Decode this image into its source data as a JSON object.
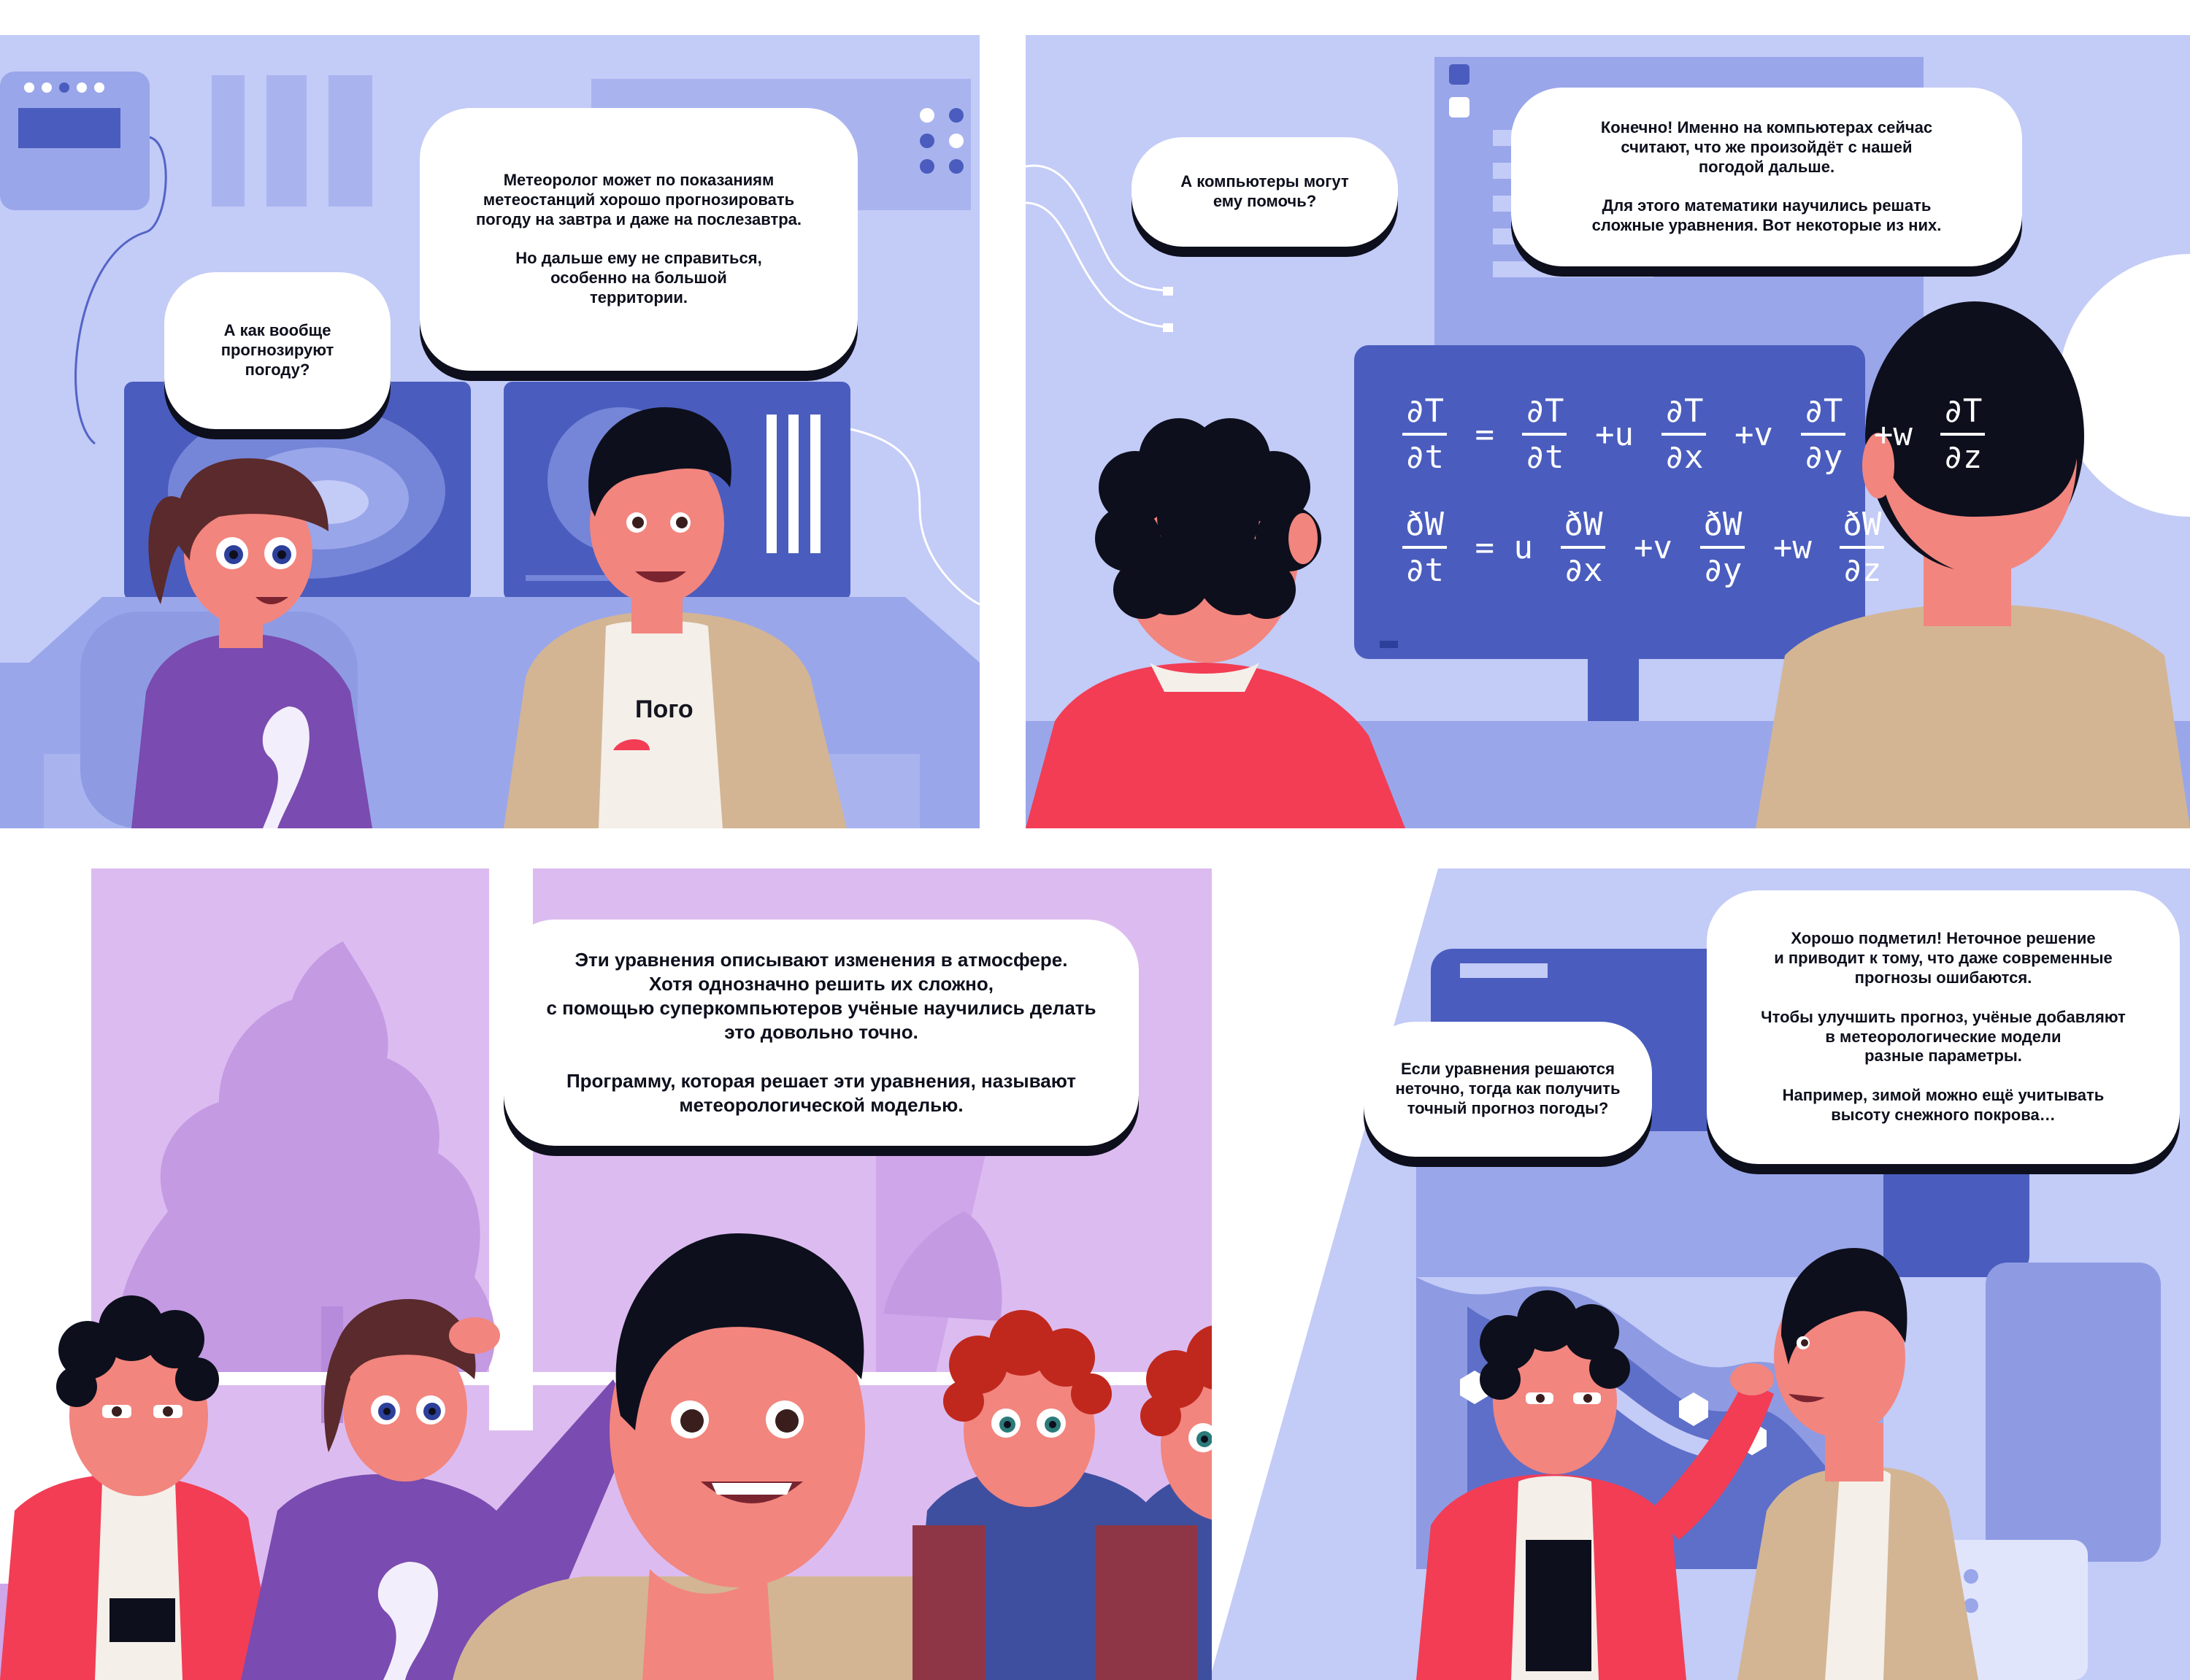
{
  "colors": {
    "panel_bg": "#c3cbf7",
    "screen_dark": "#4a5dbe",
    "screen_light": "#9aa6ea",
    "purple_bg": "#dcbcf0",
    "hoodie": "#7a4bb0",
    "jacket_red": "#f23d55",
    "beige": "#d3b594",
    "skin": "#f2857e",
    "hair": "#0d0f1c"
  },
  "panels": {
    "p1": {
      "girl_bubble": "А как вообще\nпрогнозируют\nпогоду?",
      "man_bubble": "Метеоролог может по показаниям\nметеостанций хорошо прогнозировать\nпогоду на завтра и даже на послезавтра.\n\nНо дальше ему не справиться,\nособенно на большой\nтерритории.",
      "shirt_logo": "Пого"
    },
    "p2": {
      "boy_bubble": "А компьютеры могут\nему помочь?",
      "man_bubble": "Конечно! Именно на компьютерах сейчас\nсчитают, что же произойдёт с нашей\nпогодой дальше.\n\nДля этого математики научились решать\nсложные уравнения. Вот некоторые из них.",
      "equation1": {
        "lhs": [
          "∂T",
          "∂t"
        ],
        "terms": [
          {
            "op": "=",
            "num": "∂T",
            "den": "∂t"
          },
          {
            "op": "+u",
            "num": "∂T",
            "den": "∂x"
          },
          {
            "op": "+v",
            "num": "∂T",
            "den": "∂y"
          },
          {
            "op": "+w",
            "num": "∂T",
            "den": "∂z"
          }
        ]
      },
      "equation2": {
        "lhs": [
          "ðW",
          "∂t"
        ],
        "terms": [
          {
            "op": "= u",
            "num": "ðW",
            "den": "∂x"
          },
          {
            "op": "+v",
            "num": "ðW",
            "den": "∂y"
          },
          {
            "op": "+w",
            "num": "ðW",
            "den": "∂z"
          }
        ]
      }
    },
    "p3": {
      "man_bubble": "Эти уравнения описывают изменения в атмосфере.\nХотя однозначно решить их сложно,\nс помощью суперкомпьютеров учёные научились делать\nэто довольно точно.\n\nПрограмму, которая решает эти уравнения, называют\nметеорологической моделью."
    },
    "p4": {
      "boy_bubble": "Если уравнения решаются\nнеточно, тогда как получить\nточный прогноз погоды?",
      "man_bubble": "Хорошо подметил! Неточное решение\nи приводит к тому, что даже современные\nпрогнозы ошибаются.\n\nЧтобы улучшить прогноз, учёные добавляют\nв метеорологические модели\nразные параметры.\n\nНапример, зимой можно ещё учитывать\nвысоту снежного покрова…"
    }
  }
}
